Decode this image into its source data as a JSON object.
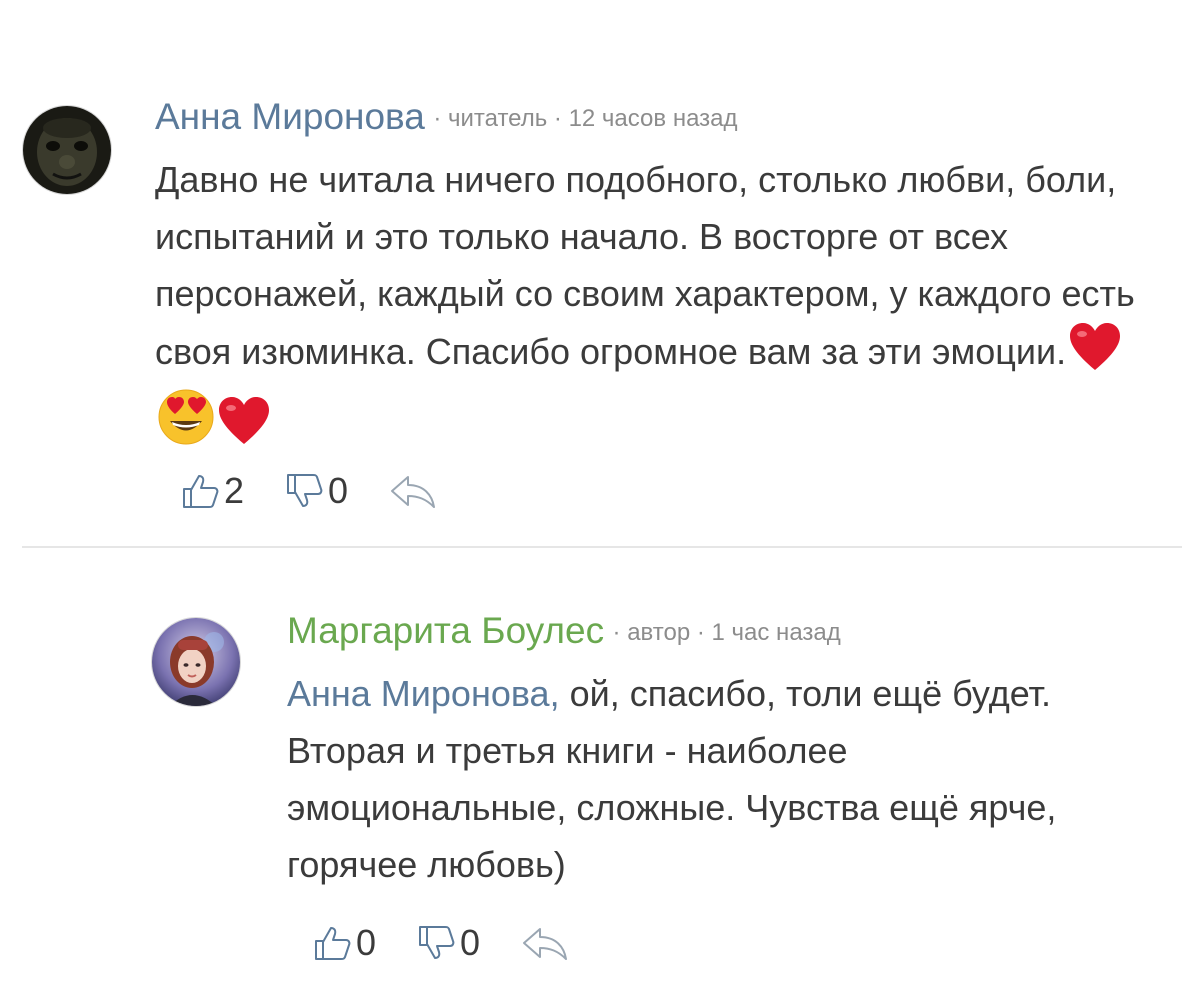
{
  "comments": [
    {
      "author": "Анна Миронова",
      "meta": "· читатель · 12 часов назад",
      "text": "Давно не читала ничего подобного, столько любви, боли, испытаний и это только начало. В восторге от всех персонажей, каждый со своим характером, у каждого есть своя изюминка. Спасибо огромное вам за эти эмоции.",
      "emojis": [
        "heart",
        "heart-eyes-smiley",
        "heart"
      ],
      "likes": "2",
      "dislikes": "0",
      "avatar_icon": "dark-face-avatar"
    },
    {
      "author": "Маргарита Боулес",
      "meta": "· автор · 1 час назад",
      "mention": "Анна Миронова,",
      "text": " ой, спасибо, толи ещё будет. Вторая и третья книги - наиболее эмоциональные, сложные. Чувства ещё ярче, горячее любовь)",
      "likes": "0",
      "dislikes": "0",
      "avatar_icon": "woman-photo-avatar"
    }
  ],
  "colors": {
    "reader_name": "#5b7a9a",
    "author_name": "#6aa84f",
    "meta": "#8c8c8c",
    "body_text": "#3b3b3b",
    "heart": "#e0182d",
    "icon_blue": "#5b7a9a"
  }
}
